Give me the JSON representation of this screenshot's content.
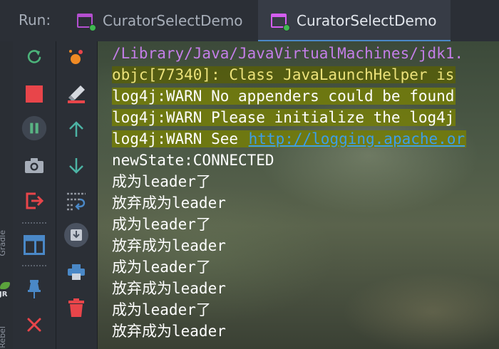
{
  "tabbar": {
    "run_label": "Run:",
    "tabs": [
      {
        "label": "CuratorSelectDemo",
        "active": false
      },
      {
        "label": "CuratorSelectDemo",
        "active": true
      }
    ]
  },
  "left_strip": {
    "text_a": "Gradle",
    "text_b": "JRebel",
    "jr_label": "JR"
  },
  "toolbar_1": {
    "icons": [
      "rerun-icon",
      "stop-icon",
      "pause-icon",
      "camera-icon",
      "exit-icon",
      "layout-icon",
      "pin-icon",
      "close-icon"
    ]
  },
  "toolbar_2": {
    "icons": [
      "debug-icon",
      "clear-icon",
      "up-arrow-icon",
      "down-arrow-icon",
      "soft-wrap-icon",
      "scroll-to-end-icon",
      "print-icon",
      "trash-icon"
    ]
  },
  "console": {
    "lines": [
      {
        "kind": "purple",
        "text": "/Library/Java/JavaVirtualMachines/jdk1."
      },
      {
        "kind": "yellow",
        "text": "objc[77340]: Class JavaLaunchHelper is "
      },
      {
        "kind": "warn",
        "text": "log4j:WARN No appenders could be found "
      },
      {
        "kind": "warn",
        "text": "log4j:WARN Please initialize the log4j "
      },
      {
        "kind": "warn-link",
        "text": "log4j:WARN See ",
        "link": "http://logging.apache.or"
      },
      {
        "kind": "normal",
        "text": "newState:CONNECTED"
      },
      {
        "kind": "normal",
        "text": "成为leader了"
      },
      {
        "kind": "normal",
        "text": "放弃成为leader"
      },
      {
        "kind": "normal",
        "text": "成为leader了"
      },
      {
        "kind": "normal",
        "text": "放弃成为leader"
      },
      {
        "kind": "normal",
        "text": "成为leader了"
      },
      {
        "kind": "normal",
        "text": "放弃成为leader"
      },
      {
        "kind": "normal",
        "text": "成为leader了"
      },
      {
        "kind": "normal",
        "text": "放弃成为leader"
      }
    ]
  },
  "colors": {
    "accent": "#4a88c7",
    "app_icon": "#d45ef0",
    "run_green": "#3fb950",
    "stop_red": "#e8454a",
    "console_purple": "#c47ee8",
    "link_blue": "#3d9ee8"
  }
}
